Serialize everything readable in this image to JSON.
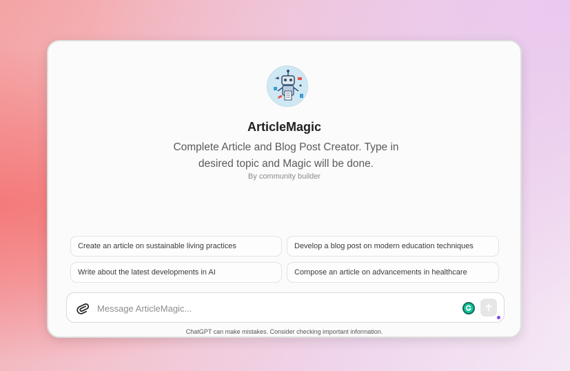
{
  "gpt": {
    "name": "ArticleMagic",
    "description": "Complete Article and Blog Post Creator. Type in desired topic and Magic will be done.",
    "author": "By community builder",
    "avatar_icon": "robot-writer-icon"
  },
  "suggestions": [
    "Create an article on sustainable living practices",
    "Develop a blog post on modern education techniques",
    "Write about the latest developments in AI",
    "Compose an article on advancements in healthcare"
  ],
  "composer": {
    "placeholder": "Message ArticleMagic...",
    "value": ""
  },
  "disclaimer": "ChatGPT can make mistakes. Consider checking important information.",
  "colors": {
    "accent_dot": "#7b4bf2",
    "grammarly": "#15c39a"
  }
}
